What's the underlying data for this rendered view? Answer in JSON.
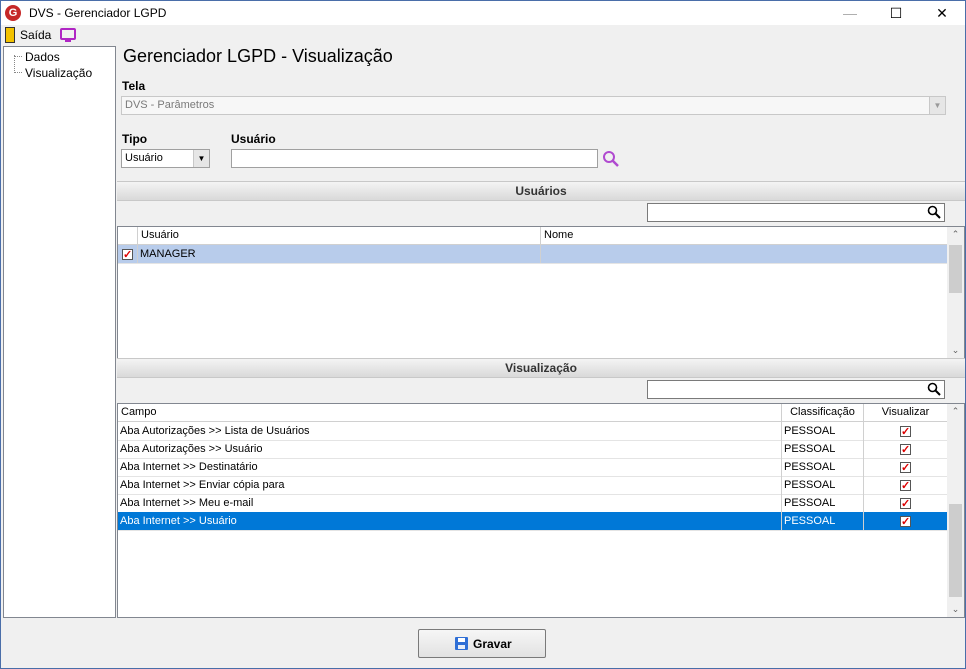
{
  "window": {
    "title": "DVS - Gerenciador LGPD",
    "minimize": "—",
    "maximize": "☐",
    "close": "✕"
  },
  "menubar": {
    "exit_label": "Saída"
  },
  "tree": {
    "items": [
      "Dados",
      "Visualização"
    ]
  },
  "page": {
    "title": "Gerenciador LGPD - Visualização"
  },
  "tela": {
    "label": "Tela",
    "value": "DVS - Parâmetros"
  },
  "tipo": {
    "label": "Tipo",
    "value": "Usuário"
  },
  "usuario": {
    "label": "Usuário",
    "value": ""
  },
  "users_section": {
    "title": "Usuários",
    "columns": [
      "Usuário",
      "Nome"
    ],
    "rows": [
      {
        "checked": true,
        "usuario": "MANAGER",
        "nome": ""
      }
    ]
  },
  "view_section": {
    "title": "Visualização",
    "columns": [
      "Campo",
      "Classificação",
      "Visualizar"
    ],
    "rows": [
      {
        "campo": "Aba Autorizações >> Lista de Usuários",
        "classificacao": "PESSOAL",
        "visualizar": true
      },
      {
        "campo": "Aba Autorizações >> Usuário",
        "classificacao": "PESSOAL",
        "visualizar": true
      },
      {
        "campo": "Aba Internet >> Destinatário",
        "classificacao": "PESSOAL",
        "visualizar": true
      },
      {
        "campo": "Aba Internet >> Enviar cópia para",
        "classificacao": "PESSOAL",
        "visualizar": true
      },
      {
        "campo": "Aba Internet >> Meu e-mail",
        "classificacao": "PESSOAL",
        "visualizar": true
      },
      {
        "campo": "Aba Internet >> Usuário",
        "classificacao": "PESSOAL",
        "visualizar": true
      }
    ],
    "selected_row": 5
  },
  "footer": {
    "save_label": "Gravar"
  },
  "colors": {
    "selection": "#0078d7",
    "user_row_selection": "#b8cceb",
    "check": "#dd0000"
  }
}
